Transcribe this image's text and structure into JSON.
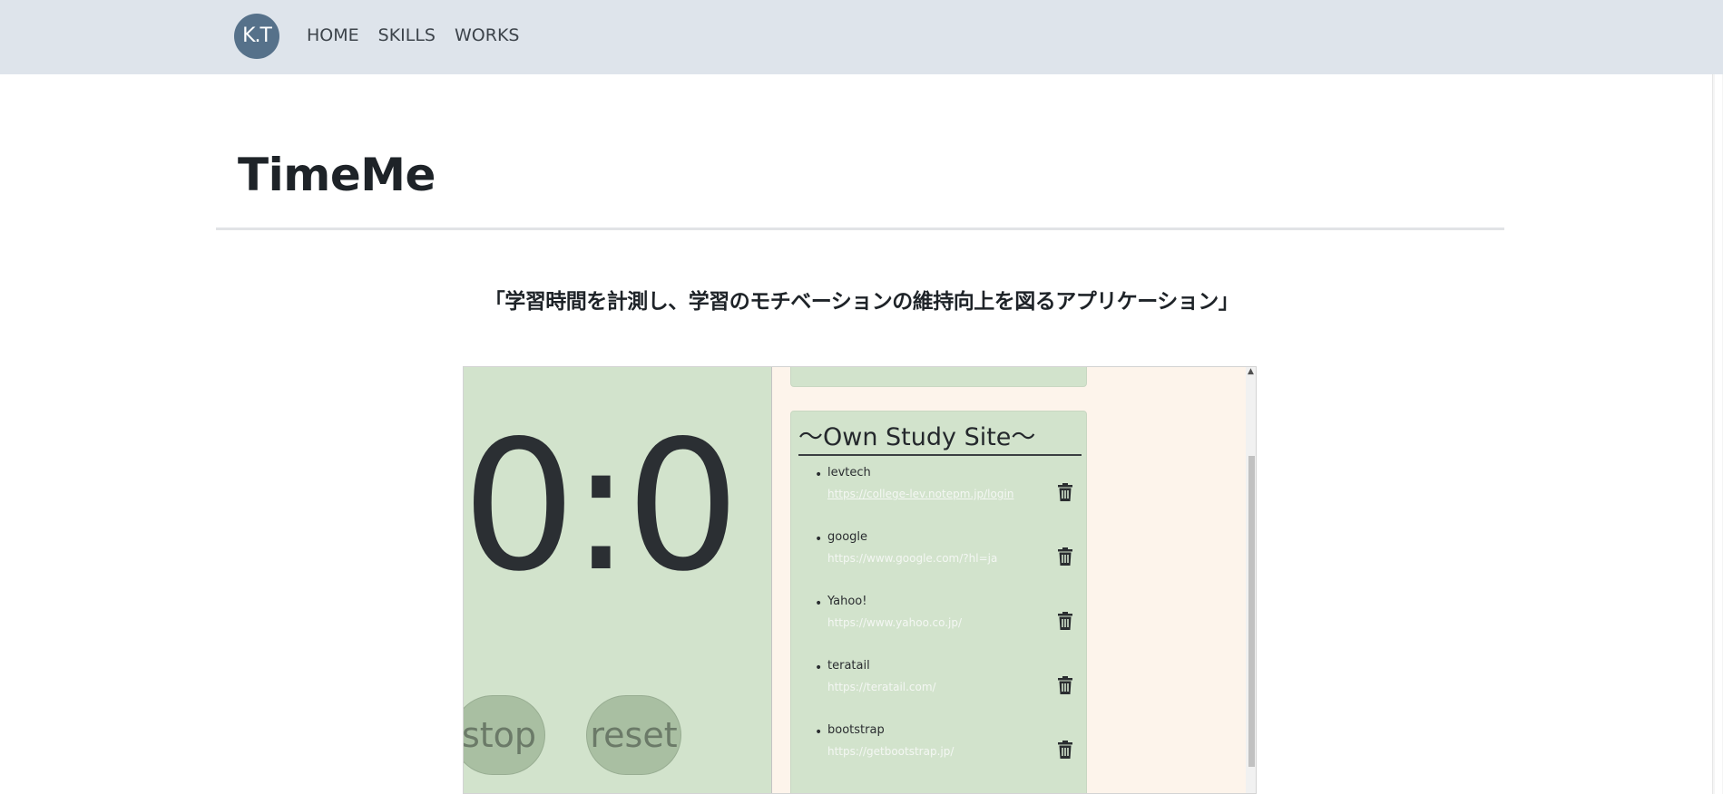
{
  "navbar": {
    "logo": "K.T",
    "links": [
      "HOME",
      "SKILLS",
      "WORKS"
    ]
  },
  "page": {
    "title": "TimeMe",
    "subtitle": "「学習時間を計測し、学習のモチベーションの維持向上を図るアプリケーション」"
  },
  "screenshot": {
    "timer": "0:0",
    "buttons": {
      "stop": "stop",
      "reset": "reset"
    },
    "site_card_title": "〜Own Study Site〜",
    "sites": [
      {
        "name": "levtech",
        "url": "https://college-lev.notepm.jp/login"
      },
      {
        "name": "google",
        "url": "https://www.google.com/?hl=ja"
      },
      {
        "name": "Yahoo!",
        "url": "https://www.yahoo.co.jp/"
      },
      {
        "name": "teratail",
        "url": "https://teratail.com/"
      },
      {
        "name": "bootstrap",
        "url": "https://getbootstrap.jp/"
      }
    ]
  },
  "colors": {
    "navbar_bg": "#dee4eb",
    "logo_bg": "#56718a",
    "panel_green": "#d2e3cc",
    "app_bg": "#fdf4eb"
  }
}
